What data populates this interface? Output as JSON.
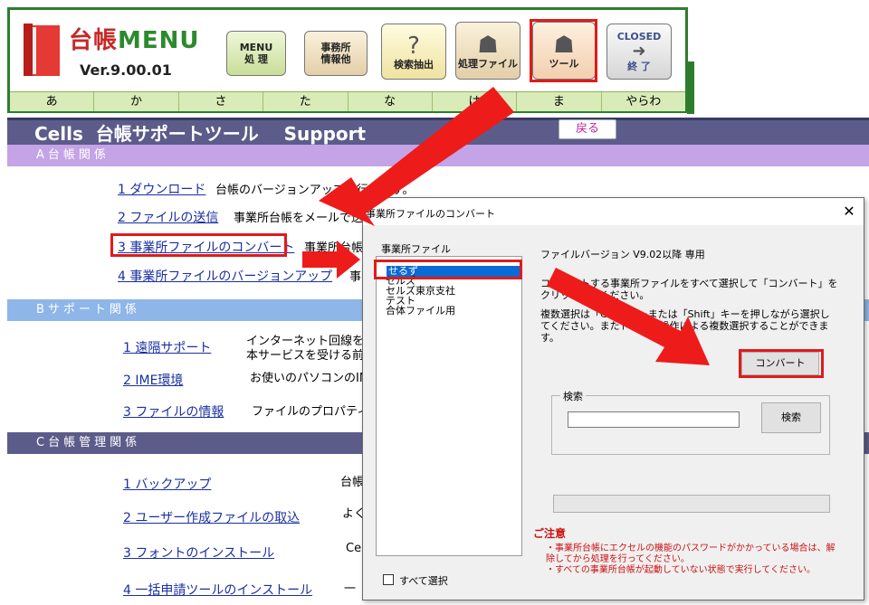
{
  "app": {
    "logo_kanji": "台帳",
    "logo_menu": "MENU",
    "version": "Ver.9.00.01"
  },
  "toolbar": {
    "menu_line1": "MENU",
    "menu_line2": "処 理",
    "jimusho_line1": "事務所",
    "jimusho_line2": "情報他",
    "search_label": "検索抽出",
    "proc_label": "処理ファイル",
    "tool_label": "ツール",
    "closed_line1": "CLOSED",
    "closed_line2": "終 了"
  },
  "kana_tabs": [
    "あ",
    "か",
    "さ",
    "た",
    "な",
    "は",
    "ま",
    "やらわ"
  ],
  "page": {
    "title": "Cells  台帳サポートツール    Support",
    "back_label": "戻る"
  },
  "sections": {
    "a_title": "A台帳関係",
    "b_title": "Bサポート関係",
    "c_title": "C台帳管理関係"
  },
  "items_a": [
    {
      "link": "1 ダウンロード",
      "desc": "台帳のバージョンアップを行います。"
    },
    {
      "link": "2 ファイルの送信",
      "desc": "事業所台帳をメールで送信"
    },
    {
      "link": "3 事業所ファイルのコンバート",
      "desc": "事業所台帳"
    },
    {
      "link": "4 事業所ファイルのバージョンアップ",
      "desc": "事"
    }
  ],
  "items_b": [
    {
      "link": "1 遠隔サポート",
      "desc": "インターネット回線を利",
      "desc2": "本サービスを受ける前"
    },
    {
      "link": "2 IME環境",
      "desc": "お使いのパソコンのIM"
    },
    {
      "link": "3 ファイルの情報",
      "desc": "ファイルのプロパティを"
    }
  ],
  "items_c": [
    {
      "link": "1 バックアップ",
      "desc": "台帳"
    },
    {
      "link": "2 ユーザー作成ファイルの取込",
      "desc": "よく"
    },
    {
      "link": "3 フォントのインストール",
      "desc": "Ce"
    },
    {
      "link": "4 一括申請ツールのインストール",
      "desc": "一"
    }
  ],
  "dialog": {
    "title": "事業所ファイルのコンバート",
    "close_glyph": "✕",
    "list_label": "事業所ファイル",
    "list_items": [
      "せるず",
      "セルズ",
      "セルズ東京支社",
      "テスト",
      "合体ファイル用"
    ],
    "select_all_label": "すべて選択",
    "version_note": "ファイルバージョン V9.02以降  専用",
    "instruction_1": "コンバートする事業所ファイルをすべて選択して「コンバート」をクリックしてください。",
    "instruction_2": "複数選択は「Ctrl」キーまたは「Shift」キーを押しながら選択してください。またドラッグ操作による複数選択することができます。",
    "convert_label": "コンバート",
    "search_group_label": "検索",
    "search_value": "",
    "search_button": "検索",
    "notice_title": "ご注意",
    "notice_1": "・事業所台帳にエクセルの機能のパスワードがかかっている場合は、解除してから処理を行ってください。",
    "notice_2": "・すべての事業所台帳が起動していない状態で実行してください。"
  },
  "colors": {
    "frame_green": "#2e7d2e",
    "header_purple": "#5c5c8a",
    "section_a": "#c4a3e6",
    "section_b": "#8fb6e8",
    "highlight_red": "#e01b1b",
    "selection_blue": "#0a6ad6"
  }
}
